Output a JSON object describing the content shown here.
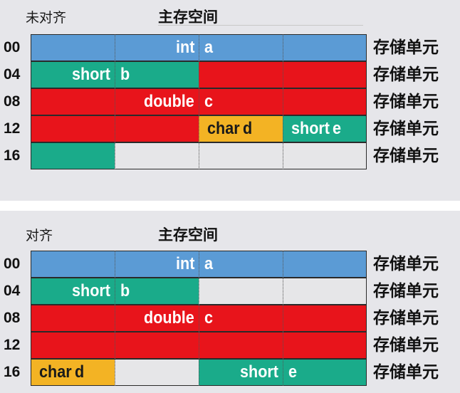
{
  "unit_label": "存储单元",
  "colors": {
    "blue": "#5b9bd5",
    "teal": "#1aab8a",
    "red": "#e8141b",
    "orange": "#f3b324",
    "empty": "#e6e6e8"
  },
  "panels": [
    {
      "caption": "未对齐",
      "title": "主存空间",
      "addresses": [
        "00",
        "04",
        "08",
        "12",
        "16"
      ],
      "blocks": [
        {
          "row": 0,
          "start": 0,
          "span": 4,
          "color": "blue",
          "type": "int",
          "var": "a",
          "dark": false
        },
        {
          "row": 1,
          "start": 0,
          "span": 2,
          "color": "teal",
          "type": "short",
          "var": "b",
          "dark": false
        },
        {
          "row": 1,
          "start": 2,
          "span": 2,
          "color": "red",
          "type": "",
          "var": "",
          "dark": false
        },
        {
          "row": 2,
          "start": 0,
          "span": 4,
          "color": "red",
          "type": "double",
          "var": "c",
          "dark": false
        },
        {
          "row": 3,
          "start": 0,
          "span": 2,
          "color": "red",
          "type": "",
          "var": "",
          "dark": false
        },
        {
          "row": 3,
          "start": 2,
          "span": 1,
          "color": "orange",
          "type": "char",
          "var": "d",
          "dark": true
        },
        {
          "row": 3,
          "start": 3,
          "span": 1,
          "color": "teal",
          "type": "short",
          "var": "e",
          "dark": false
        },
        {
          "row": 4,
          "start": 0,
          "span": 1,
          "color": "teal",
          "type": "",
          "var": "",
          "dark": false
        },
        {
          "row": 4,
          "start": 1,
          "span": 3,
          "color": "empty",
          "type": "",
          "var": "",
          "dark": false
        }
      ]
    },
    {
      "caption": "对齐",
      "title": "主存空间",
      "addresses": [
        "00",
        "04",
        "08",
        "12",
        "16"
      ],
      "blocks": [
        {
          "row": 0,
          "start": 0,
          "span": 4,
          "color": "blue",
          "type": "int",
          "var": "a",
          "dark": false
        },
        {
          "row": 1,
          "start": 0,
          "span": 2,
          "color": "teal",
          "type": "short",
          "var": "b",
          "dark": false
        },
        {
          "row": 1,
          "start": 2,
          "span": 2,
          "color": "empty",
          "type": "",
          "var": "",
          "dark": false
        },
        {
          "row": 2,
          "start": 0,
          "span": 4,
          "color": "red",
          "type": "double",
          "var": "c",
          "dark": false
        },
        {
          "row": 3,
          "start": 0,
          "span": 4,
          "color": "red",
          "type": "",
          "var": "",
          "dark": false
        },
        {
          "row": 4,
          "start": 0,
          "span": 1,
          "color": "orange",
          "type": "char",
          "var": "d",
          "dark": true
        },
        {
          "row": 4,
          "start": 1,
          "span": 1,
          "color": "empty",
          "type": "",
          "var": "",
          "dark": false
        },
        {
          "row": 4,
          "start": 2,
          "span": 2,
          "color": "teal",
          "type": "short",
          "var": "e",
          "dark": false
        }
      ]
    }
  ]
}
